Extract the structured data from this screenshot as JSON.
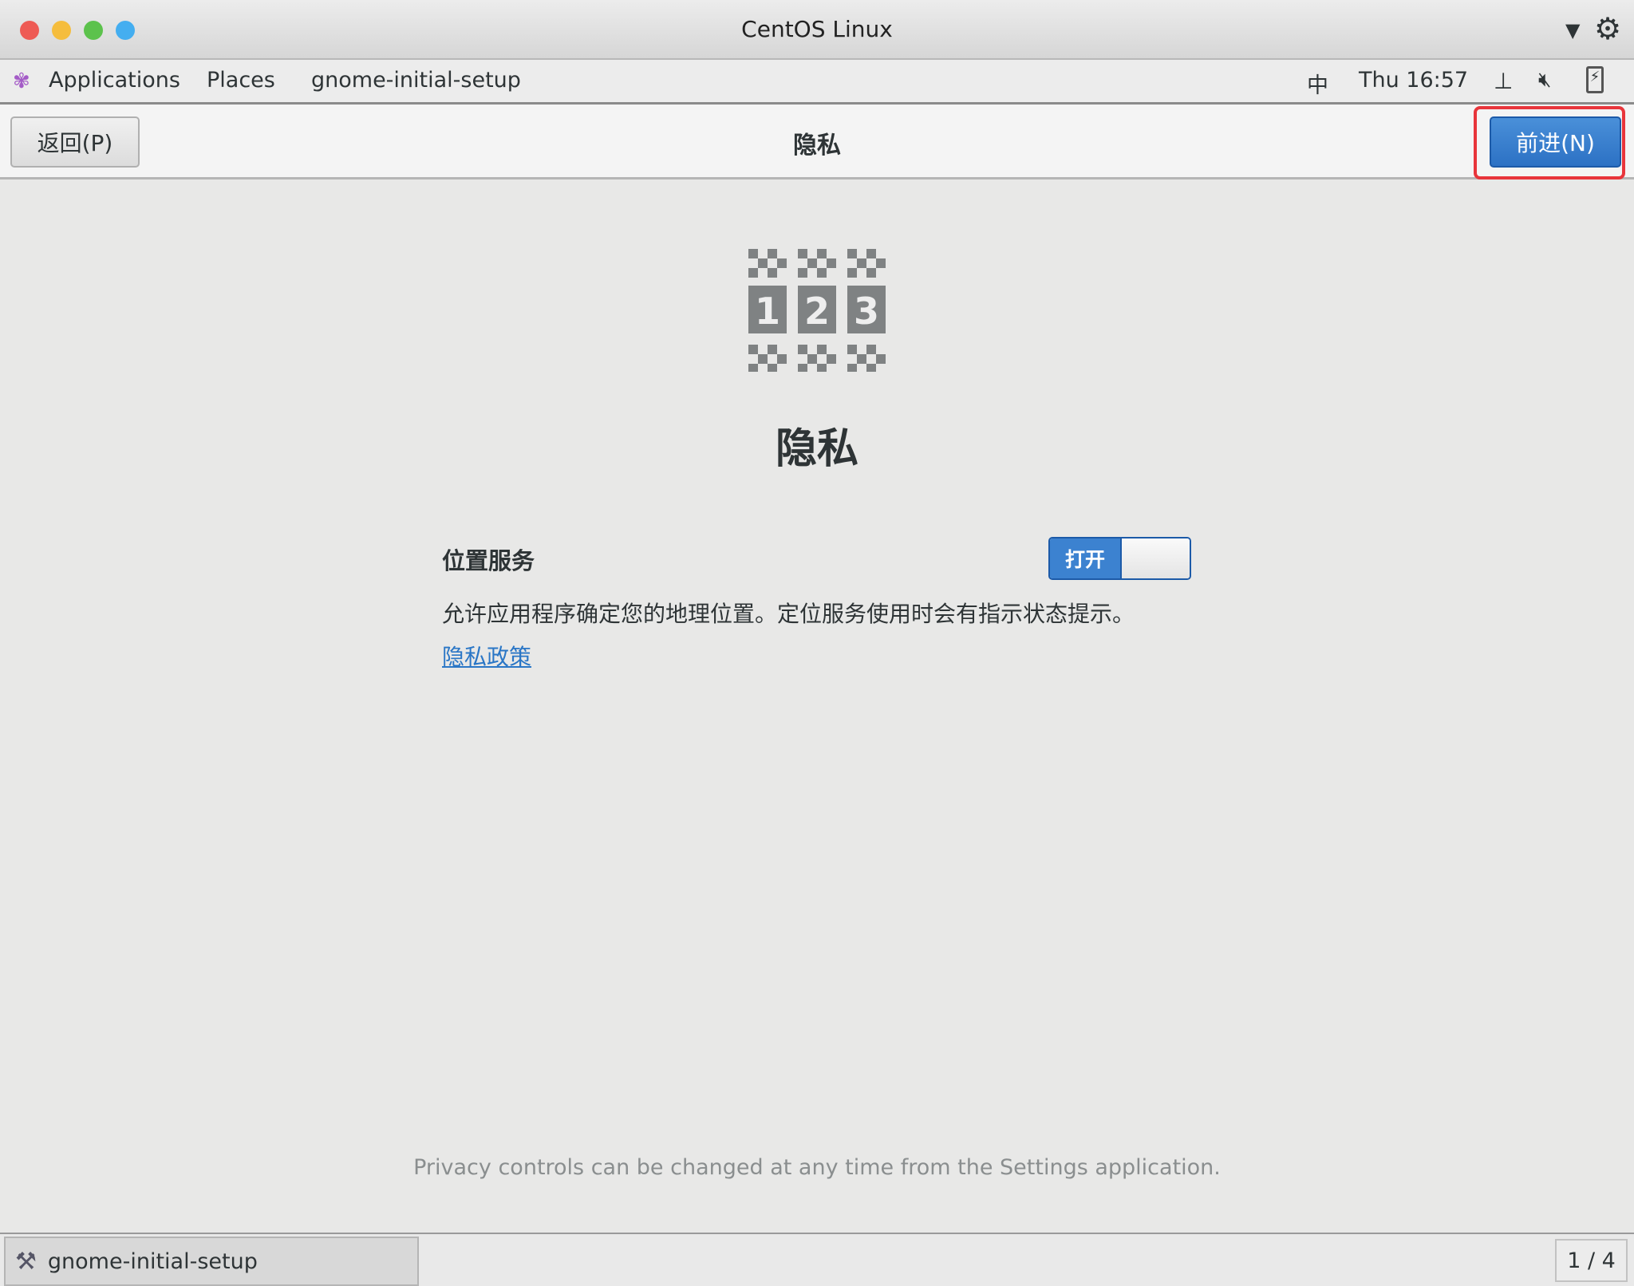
{
  "window": {
    "title": "CentOS Linux"
  },
  "menubar": {
    "applications": "Applications",
    "places": "Places",
    "app": "gnome-initial-setup",
    "input_method": "中",
    "clock": "Thu 16:57"
  },
  "header": {
    "back": "返回(P)",
    "title": "隐私",
    "next": "前进(N)"
  },
  "main": {
    "heading": "隐私",
    "location_label": "位置服务",
    "toggle_label": "打开",
    "toggle_on": true,
    "description": "允许应用程序确定您的地理位置。定位服务使用时会有指示状态提示。",
    "policy_link": "隐私政策",
    "footer": "Privacy controls can be changed at any time from the Settings application.",
    "icon_digits": [
      "1",
      "2",
      "3"
    ]
  },
  "taskbar": {
    "task": "gnome-initial-setup",
    "pager": "1 / 4"
  },
  "colors": {
    "accent": "#3c82d0",
    "highlight": "#e8353b"
  }
}
